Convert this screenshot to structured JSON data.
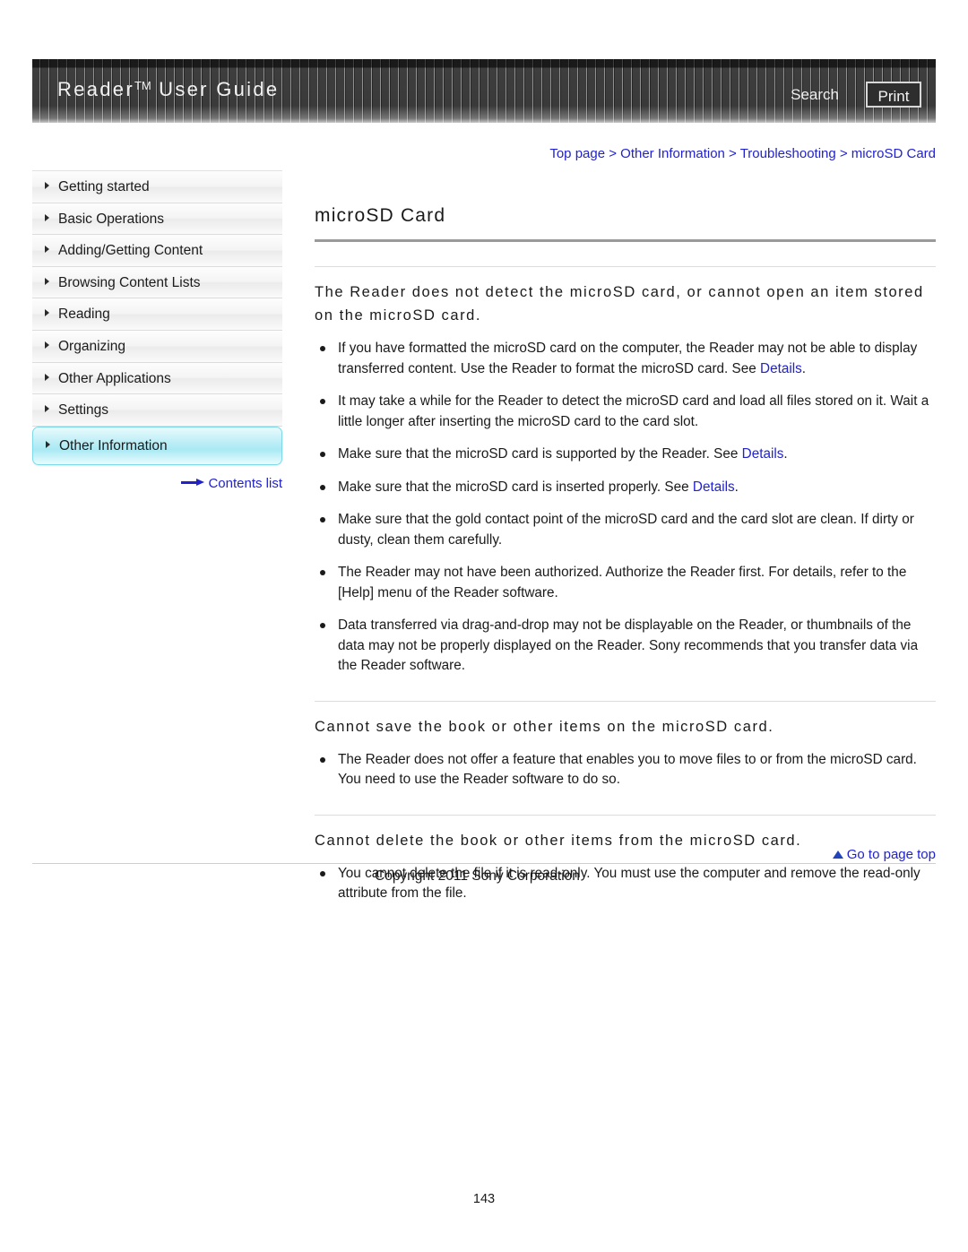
{
  "header": {
    "title_main": "Reader",
    "title_tm": "TM",
    "title_rest": " User Guide",
    "search_label": "Search",
    "print_label": "Print"
  },
  "breadcrumb": {
    "text": "Top page > Other Information > Troubleshooting > microSD Card"
  },
  "sidebar": {
    "items": [
      {
        "label": "Getting started"
      },
      {
        "label": "Basic Operations"
      },
      {
        "label": "Adding/Getting Content"
      },
      {
        "label": "Browsing Content Lists"
      },
      {
        "label": "Reading"
      },
      {
        "label": "Organizing"
      },
      {
        "label": "Other Applications"
      },
      {
        "label": "Settings"
      },
      {
        "label": "Other Information"
      }
    ],
    "active_index": 8,
    "contents_list_label": "Contents list"
  },
  "main": {
    "page_title": "microSD Card",
    "sections": [
      {
        "heading": "The Reader does not detect the microSD card, or cannot open an item stored on the microSD card.",
        "bullets": [
          {
            "pre": "If you have formatted the microSD card on the computer, the Reader may not be able to display transferred content. Use the Reader to format the microSD card. See ",
            "link": "Details",
            "post": "."
          },
          {
            "pre": "It may take a while for the Reader to detect the microSD card and load all files stored on it. Wait a little longer after inserting the microSD card to the card slot.",
            "link": "",
            "post": ""
          },
          {
            "pre": "Make sure that the microSD card is supported by the Reader. See ",
            "link": "Details",
            "post": "."
          },
          {
            "pre": "Make sure that the microSD card is inserted properly. See ",
            "link": "Details",
            "post": "."
          },
          {
            "pre": "Make sure that the gold contact point of the microSD card and the card slot are clean. If dirty or dusty, clean them carefully.",
            "link": "",
            "post": ""
          },
          {
            "pre": "The Reader may not have been authorized. Authorize the Reader first. For details, refer to the [Help] menu of the Reader software.",
            "link": "",
            "post": ""
          },
          {
            "pre": "Data transferred via drag-and-drop may not be displayable on the Reader, or thumbnails of the data may not be properly displayed on the Reader. Sony recommends that you transfer data via the Reader software.",
            "link": "",
            "post": ""
          }
        ]
      },
      {
        "heading": "Cannot save the book or other items on the microSD card.",
        "bullets": [
          {
            "pre": "The Reader does not offer a feature that enables you to move files to or from the microSD card. You need to use the Reader software to do so.",
            "link": "",
            "post": ""
          }
        ]
      },
      {
        "heading": "Cannot delete the book or other items from the microSD card.",
        "bullets": [
          {
            "pre": "You cannot delete the file if it is read-only. You must use the computer and remove the read-only attribute from the file.",
            "link": "",
            "post": ""
          }
        ]
      }
    ]
  },
  "page_top_label": "Go to page top",
  "footer": {
    "copyright": "Copyright 2011 Sony Corporation",
    "page_number": "143"
  },
  "colors": {
    "link": "#2222cc",
    "banner_bg": "#2b2b2b",
    "active_nav": "#a9e9f4"
  }
}
